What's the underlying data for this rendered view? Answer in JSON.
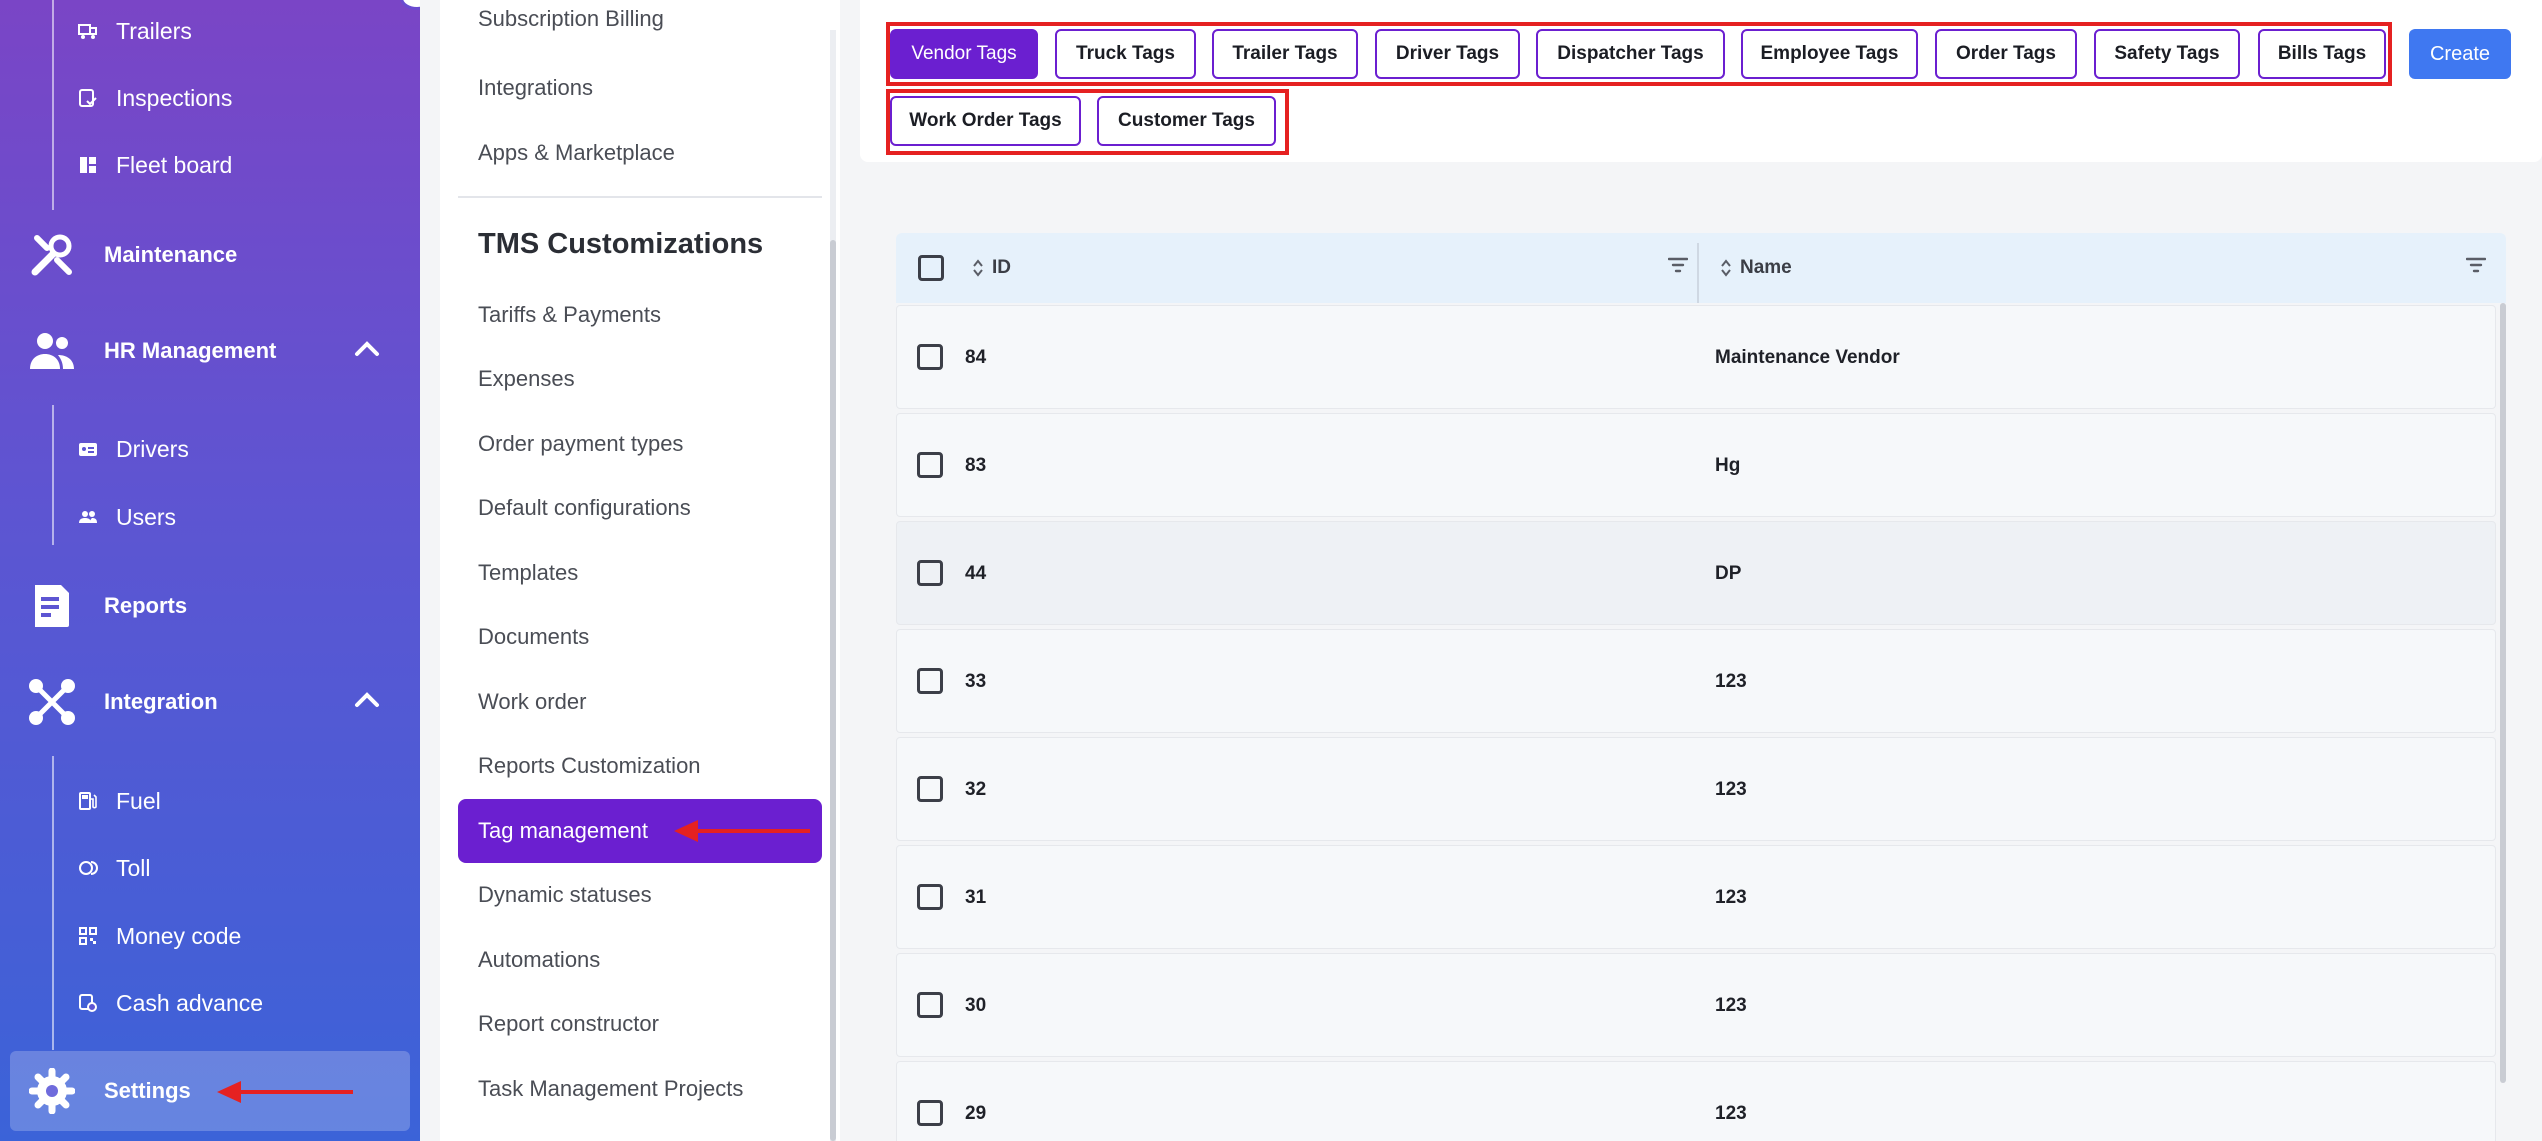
{
  "sidebar": {
    "items": [
      {
        "type": "sub",
        "label": "Trailers",
        "icon": "truck-icon"
      },
      {
        "type": "sub",
        "label": "Inspections",
        "icon": "clipboard-icon"
      },
      {
        "type": "sub",
        "label": "Fleet board",
        "icon": "board-icon"
      },
      {
        "type": "main",
        "label": "Maintenance",
        "icon": "wrench-icon"
      },
      {
        "type": "main",
        "label": "HR Management",
        "icon": "people-icon",
        "expanded": true
      },
      {
        "type": "sub",
        "label": "Drivers",
        "icon": "id-card-icon"
      },
      {
        "type": "sub",
        "label": "Users",
        "icon": "users-icon"
      },
      {
        "type": "main",
        "label": "Reports",
        "icon": "report-icon"
      },
      {
        "type": "main",
        "label": "Integration",
        "icon": "integration-icon",
        "expanded": true
      },
      {
        "type": "sub",
        "label": "Fuel",
        "icon": "fuel-icon"
      },
      {
        "type": "sub",
        "label": "Toll",
        "icon": "toll-icon"
      },
      {
        "type": "sub",
        "label": "Money code",
        "icon": "qr-icon"
      },
      {
        "type": "sub",
        "label": "Cash advance",
        "icon": "cash-icon"
      },
      {
        "type": "main",
        "label": "Settings",
        "icon": "gear-icon",
        "active": true
      }
    ]
  },
  "settings_menu": {
    "top_items": [
      "Subscription Billing",
      "Integrations",
      "Apps & Marketplace"
    ],
    "heading": "TMS Customizations",
    "items": [
      "Tariffs & Payments",
      "Expenses",
      "Order payment types",
      "Default configurations",
      "Templates",
      "Documents",
      "Work order",
      "Reports Customization",
      "Tag management",
      "Dynamic statuses",
      "Automations",
      "Report constructor",
      "Task Management Projects"
    ],
    "active": "Tag management"
  },
  "tag_tabs": [
    {
      "label": "Vendor Tags",
      "active": true
    },
    {
      "label": "Truck Tags"
    },
    {
      "label": "Trailer Tags"
    },
    {
      "label": "Driver Tags"
    },
    {
      "label": "Dispatcher Tags"
    },
    {
      "label": "Employee Tags"
    },
    {
      "label": "Order Tags"
    },
    {
      "label": "Safety Tags"
    },
    {
      "label": "Bills Tags"
    },
    {
      "label": "Work Order Tags"
    },
    {
      "label": "Customer Tags"
    }
  ],
  "create_label": "Create",
  "table": {
    "columns": [
      "ID",
      "Name"
    ],
    "rows": [
      {
        "id": "84",
        "name": "Maintenance Vendor"
      },
      {
        "id": "83",
        "name": "Hg"
      },
      {
        "id": "44",
        "name": "DP"
      },
      {
        "id": "33",
        "name": "123"
      },
      {
        "id": "32",
        "name": "123"
      },
      {
        "id": "31",
        "name": "123"
      },
      {
        "id": "30",
        "name": "123"
      },
      {
        "id": "29",
        "name": "123"
      }
    ]
  },
  "colors": {
    "accent": "#6b1fd0",
    "create": "#3f78f1",
    "annotation": "#e52121",
    "header_bg": "#e6f1fb"
  }
}
